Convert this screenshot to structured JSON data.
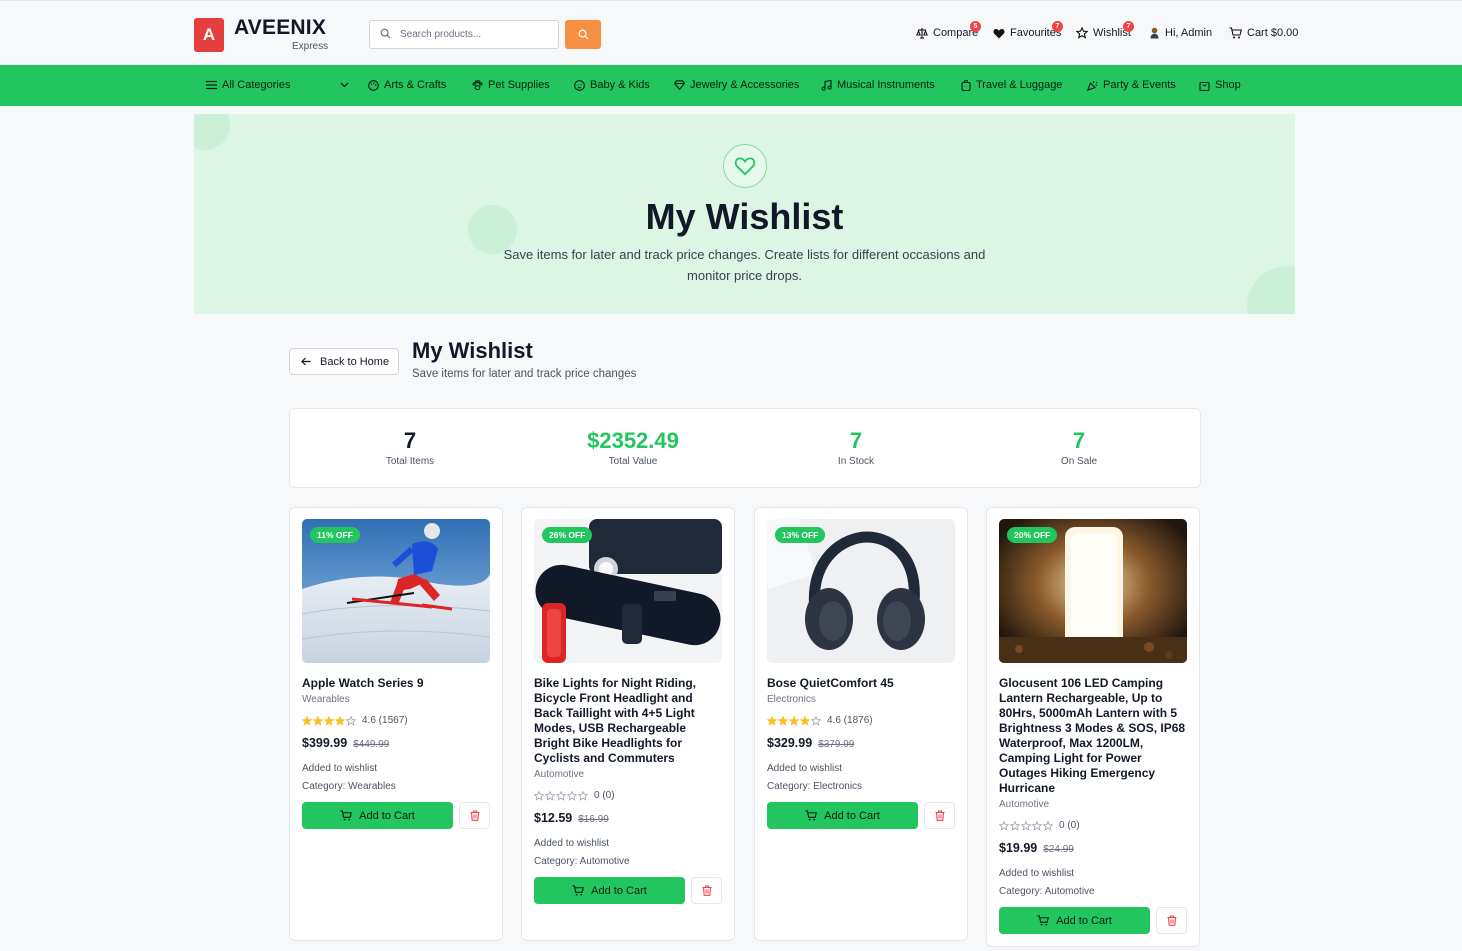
{
  "brand": {
    "letter": "A",
    "name": "AVEENIX",
    "sub": "Express"
  },
  "search": {
    "placeholder": "Search products..."
  },
  "header_links": {
    "compare": {
      "label": "Compare",
      "count": "5"
    },
    "favourites": {
      "label": "Favourites",
      "count": "7"
    },
    "wishlist": {
      "label": "Wishlist",
      "count": "7"
    },
    "account": {
      "label": "Hi, Admin"
    },
    "cart": {
      "label": "Cart $0.00"
    }
  },
  "nav": {
    "all_categories": "All Categories",
    "items": [
      "Arts & Crafts",
      "Pet Supplies",
      "Baby & Kids",
      "Jewelry & Accessories",
      "Musical Instruments",
      "Travel & Luggage",
      "Party & Events",
      "Shop"
    ]
  },
  "hero": {
    "title": "My Wishlist",
    "subtitle": "Save items for later and track price changes. Create lists for different occasions and monitor price drops."
  },
  "page": {
    "back_label": "Back to Home",
    "title": "My Wishlist",
    "subtitle": "Save items for later and track price changes"
  },
  "stats": [
    {
      "value": "7",
      "label": "Total Items",
      "color": "#111827"
    },
    {
      "value": "$2352.49",
      "label": "Total Value",
      "color": "#22c55e"
    },
    {
      "value": "7",
      "label": "In Stock",
      "color": "#22c55e"
    },
    {
      "value": "7",
      "label": "On Sale",
      "color": "#22c55e"
    }
  ],
  "products": [
    {
      "badge": "11% OFF",
      "name": "Apple Watch Series 9",
      "category": "Wearables",
      "rating_text": "4.6 (1567)",
      "stars_filled": 4,
      "price": "$399.99",
      "old_price": "$449.99",
      "added": "Added to wishlist",
      "category_line": "Category: Wearables",
      "cart_label": "Add to Cart",
      "image": "skier-photo"
    },
    {
      "badge": "26% OFF",
      "name": "Bike Lights for Night Riding, Bicycle Front Headlight and Back Taillight with 4+5 Light Modes, USB Rechargeable Bright Bike Headlights for Cyclists and Commuters",
      "category": "Automotive",
      "rating_text": "0 (0)",
      "stars_filled": 0,
      "price": "$12.59",
      "old_price": "$16.99",
      "added": "Added to wishlist",
      "category_line": "Category: Automotive",
      "cart_label": "Add to Cart",
      "image": "bike-light-photo"
    },
    {
      "badge": "13% OFF",
      "name": "Bose QuietComfort 45",
      "category": "Electronics",
      "rating_text": "4.6 (1876)",
      "stars_filled": 4,
      "price": "$329.99",
      "old_price": "$379.99",
      "added": "Added to wishlist",
      "category_line": "Category: Electronics",
      "cart_label": "Add to Cart",
      "image": "headphones-photo"
    },
    {
      "badge": "20% OFF",
      "name": "Glocusent 106 LED Camping Lantern Rechargeable, Up to 80Hrs, 5000mAh Lantern with 5 Brightness 3 Modes & SOS, IP68 Waterproof, Max 1200LM, Camping Light for Power Outages Hiking Emergency Hurricane",
      "category": "Automotive",
      "rating_text": "0 (0)",
      "stars_filled": 0,
      "price": "$19.99",
      "old_price": "$24.99",
      "added": "Added to wishlist",
      "category_line": "Category: Automotive",
      "cart_label": "Add to Cart",
      "image": "lantern-photo"
    }
  ],
  "colors": {
    "accent": "#22c55e",
    "search_button": "#f59042",
    "brand": "#e53e3e",
    "star": "#fbbf24",
    "danger": "#ef4444"
  }
}
